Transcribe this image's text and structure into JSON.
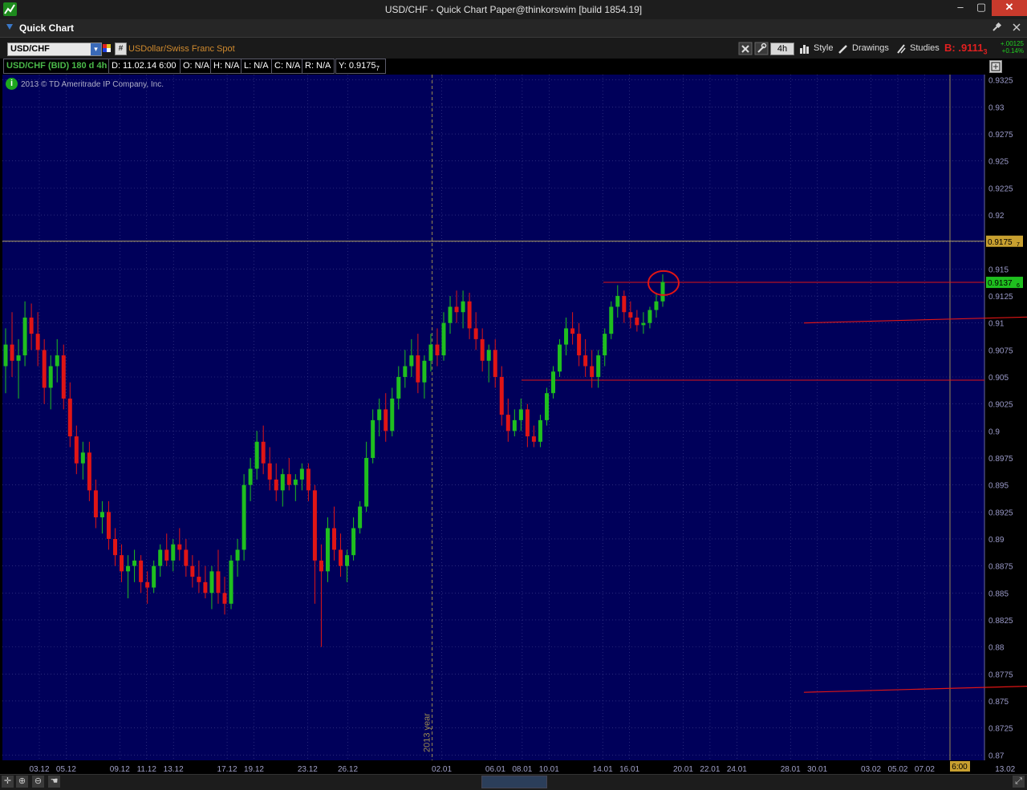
{
  "window": {
    "title": "USD/CHF - Quick Chart Paper@thinkorswim [build 1854.19]",
    "min_glyph": "–",
    "max_glyph": "▢",
    "close_glyph": "✕"
  },
  "panel": {
    "title": "Quick Chart"
  },
  "toolbar": {
    "symbol": "USD/CHF",
    "symbol_description": "USDollar/Swiss Franc Spot",
    "timeframe": "4h",
    "style_label": "Style",
    "drawings_label": "Drawings",
    "studies_label": "Studies",
    "bid_label": "B: .9111",
    "bid_sub": "3",
    "change_abs": "+.00125",
    "change_pct": "+0.14%"
  },
  "info": {
    "symbol_period": "USD/CHF (BID) 180 d 4h",
    "date": "D: 11.02.14 6:00",
    "open": "O: N/A",
    "high": "H: N/A",
    "low": "L: N/A",
    "close": "C: N/A",
    "range": "R: N/A",
    "y": "Y: 0.9175",
    "y_sub": "7"
  },
  "copyright": "2013 © TD Ameritrade IP Company, Inc.",
  "colors": {
    "background": "#00005a",
    "grid": "#444490",
    "up": "#1fbf1f",
    "down": "#e01515",
    "trend": "#e01515",
    "axis_text": "#9a9ac8",
    "date_text": "#a0a0c8",
    "crosshair": "#b0a060"
  },
  "chart_data": {
    "type": "candlestick",
    "title": "USD/CHF (BID) 180 d 4h",
    "y_ticks": [
      0.9325,
      0.93,
      0.9275,
      0.925,
      0.9225,
      0.92,
      0.9175,
      0.915,
      0.9125,
      0.91,
      0.9075,
      0.905,
      0.9025,
      0.9,
      0.8975,
      0.895,
      0.8925,
      0.89,
      0.8875,
      0.885,
      0.8825,
      0.88,
      0.8775,
      0.875,
      0.8725,
      0.87
    ],
    "y_tick_labels": [
      "0.9325",
      "0.93",
      "0.9275",
      "0.925",
      "0.9225",
      "0.92",
      "0.9175",
      "0.915",
      "0.9125",
      "0.91",
      "0.9075",
      "0.905",
      "0.9025",
      "0.9",
      "0.8975",
      "0.895",
      "0.8925",
      "0.89",
      "0.8875",
      "0.885",
      "0.8825",
      "0.88",
      "0.8775",
      "0.875",
      "0.8725",
      "0.87"
    ],
    "ylim": [
      0.8695,
      0.933
    ],
    "x_ticks": [
      "03.12",
      "05.12",
      "09.12",
      "11.12",
      "13.12",
      "17.12",
      "19.12",
      "23.12",
      "26.12",
      "02.01",
      "06.01",
      "08.01",
      "10.01",
      "14.01",
      "16.01",
      "20.01",
      "22.01",
      "24.01",
      "28.01",
      "30.01",
      "03.02",
      "05.02",
      "07.02",
      "13.02"
    ],
    "current_time_label": "6:00",
    "year_marker": "2013 year",
    "crosshair_price": 0.91757,
    "crosshair_label": "0.9175",
    "crosshair_label_sub": "7",
    "last_price": 0.91376,
    "last_price_label": "0.9137",
    "last_price_label_sub": "6",
    "horizontal_lines": [
      0.91376,
      0.9047
    ],
    "trend_lines": [
      {
        "from": [
          "29.11",
          0.92
        ],
        "to": [
          "29.01",
          0.91
        ]
      },
      {
        "from": [
          "29.11",
          0.886
        ],
        "to": [
          "29.01",
          0.8758
        ]
      }
    ],
    "highlight_circle": {
      "date": "21.01",
      "price": 0.9137
    },
    "candles": [
      [
        "02.12 00:00",
        0.906,
        0.9095,
        0.9035,
        0.908
      ],
      [
        "02.12 08:00",
        0.908,
        0.911,
        0.905,
        0.9065
      ],
      [
        "02.12 16:00",
        0.9065,
        0.9085,
        0.903,
        0.907
      ],
      [
        "03.12 00:00",
        0.907,
        0.912,
        0.906,
        0.9105
      ],
      [
        "03.12 08:00",
        0.9105,
        0.9118,
        0.9075,
        0.909
      ],
      [
        "03.12 16:00",
        0.909,
        0.911,
        0.906,
        0.9075
      ],
      [
        "04.12 00:00",
        0.9075,
        0.9085,
        0.9025,
        0.904
      ],
      [
        "04.12 08:00",
        0.904,
        0.907,
        0.902,
        0.906
      ],
      [
        "04.12 16:00",
        0.906,
        0.9085,
        0.9045,
        0.907
      ],
      [
        "05.12 00:00",
        0.907,
        0.908,
        0.902,
        0.903
      ],
      [
        "05.12 08:00",
        0.903,
        0.9045,
        0.8985,
        0.8995
      ],
      [
        "05.12 16:00",
        0.8995,
        0.9005,
        0.896,
        0.897
      ],
      [
        "06.12 00:00",
        0.897,
        0.899,
        0.8955,
        0.898
      ],
      [
        "06.12 08:00",
        0.898,
        0.899,
        0.8935,
        0.8945
      ],
      [
        "06.12 16:00",
        0.8945,
        0.8955,
        0.891,
        0.892
      ],
      [
        "09.12 00:00",
        0.892,
        0.8935,
        0.8905,
        0.8925
      ],
      [
        "09.12 08:00",
        0.8925,
        0.8935,
        0.889,
        0.89
      ],
      [
        "09.12 16:00",
        0.89,
        0.891,
        0.8875,
        0.8885
      ],
      [
        "10.12 00:00",
        0.8885,
        0.8895,
        0.886,
        0.887
      ],
      [
        "10.12 08:00",
        0.887,
        0.8885,
        0.8845,
        0.8875
      ],
      [
        "10.12 16:00",
        0.8875,
        0.889,
        0.886,
        0.888
      ],
      [
        "11.12 00:00",
        0.888,
        0.8885,
        0.885,
        0.886
      ],
      [
        "11.12 08:00",
        0.886,
        0.887,
        0.884,
        0.8855
      ],
      [
        "11.12 16:00",
        0.8855,
        0.888,
        0.885,
        0.8875
      ],
      [
        "12.12 00:00",
        0.8875,
        0.8895,
        0.8865,
        0.889
      ],
      [
        "12.12 08:00",
        0.889,
        0.8905,
        0.8875,
        0.888
      ],
      [
        "12.12 16:00",
        0.888,
        0.89,
        0.887,
        0.8895
      ],
      [
        "13.12 00:00",
        0.8895,
        0.891,
        0.888,
        0.889
      ],
      [
        "13.12 08:00",
        0.889,
        0.89,
        0.8865,
        0.8875
      ],
      [
        "13.12 16:00",
        0.8875,
        0.8885,
        0.8855,
        0.8865
      ],
      [
        "16.12 00:00",
        0.8865,
        0.888,
        0.885,
        0.886
      ],
      [
        "16.12 08:00",
        0.886,
        0.8875,
        0.8845,
        0.885
      ],
      [
        "16.12 16:00",
        0.885,
        0.8875,
        0.8835,
        0.887
      ],
      [
        "17.12 00:00",
        0.887,
        0.889,
        0.884,
        0.885
      ],
      [
        "17.12 08:00",
        0.885,
        0.8865,
        0.883,
        0.884
      ],
      [
        "17.12 16:00",
        0.884,
        0.8885,
        0.8835,
        0.888
      ],
      [
        "18.12 00:00",
        0.888,
        0.89,
        0.8865,
        0.889
      ],
      [
        "18.12 08:00",
        0.889,
        0.896,
        0.888,
        0.895
      ],
      [
        "18.12 16:00",
        0.895,
        0.8975,
        0.8935,
        0.8965
      ],
      [
        "19.12 00:00",
        0.8965,
        0.9,
        0.8955,
        0.899
      ],
      [
        "19.12 08:00",
        0.899,
        0.9005,
        0.896,
        0.897
      ],
      [
        "19.12 16:00",
        0.897,
        0.8985,
        0.8945,
        0.8955
      ],
      [
        "20.12 00:00",
        0.8955,
        0.897,
        0.8935,
        0.8945
      ],
      [
        "20.12 08:00",
        0.8945,
        0.8965,
        0.893,
        0.896
      ],
      [
        "20.12 16:00",
        0.896,
        0.8975,
        0.8945,
        0.895
      ],
      [
        "23.12 00:00",
        0.895,
        0.896,
        0.8935,
        0.8955
      ],
      [
        "23.12 08:00",
        0.8955,
        0.897,
        0.8945,
        0.8965
      ],
      [
        "23.12 16:00",
        0.8965,
        0.897,
        0.8935,
        0.8945
      ],
      [
        "24.12 00:00",
        0.8945,
        0.895,
        0.884,
        0.888
      ],
      [
        "24.12 08:00",
        0.888,
        0.8895,
        0.88,
        0.887
      ],
      [
        "24.12 16:00",
        0.887,
        0.892,
        0.886,
        0.891
      ],
      [
        "26.12 00:00",
        0.891,
        0.893,
        0.888,
        0.889
      ],
      [
        "26.12 08:00",
        0.889,
        0.8905,
        0.8865,
        0.8875
      ],
      [
        "26.12 16:00",
        0.8875,
        0.889,
        0.886,
        0.8885
      ],
      [
        "27.12 00:00",
        0.8885,
        0.892,
        0.888,
        0.891
      ],
      [
        "27.12 08:00",
        0.891,
        0.8935,
        0.8905,
        0.893
      ],
      [
        "27.12 16:00",
        0.893,
        0.899,
        0.8925,
        0.8975
      ],
      [
        "30.12 00:00",
        0.8975,
        0.902,
        0.897,
        0.901
      ],
      [
        "30.12 08:00",
        0.901,
        0.903,
        0.8995,
        0.902
      ],
      [
        "30.12 16:00",
        0.902,
        0.9035,
        0.899,
        0.9
      ],
      [
        "31.12 00:00",
        0.9,
        0.904,
        0.8995,
        0.903
      ],
      [
        "31.12 08:00",
        0.903,
        0.906,
        0.902,
        0.905
      ],
      [
        "02.01 00:00",
        0.905,
        0.9075,
        0.904,
        0.906
      ],
      [
        "02.01 08:00",
        0.906,
        0.9085,
        0.905,
        0.907
      ],
      [
        "02.01 16:00",
        0.907,
        0.909,
        0.9035,
        0.9045
      ],
      [
        "03.01 00:00",
        0.9045,
        0.907,
        0.903,
        0.9065
      ],
      [
        "03.01 08:00",
        0.9065,
        0.909,
        0.9055,
        0.908
      ],
      [
        "03.01 16:00",
        0.908,
        0.9095,
        0.906,
        0.907
      ],
      [
        "06.01 00:00",
        0.907,
        0.911,
        0.9065,
        0.91
      ],
      [
        "06.01 08:00",
        0.91,
        0.9125,
        0.909,
        0.9115
      ],
      [
        "06.01 16:00",
        0.9115,
        0.913,
        0.91,
        0.911
      ],
      [
        "07.01 00:00",
        0.911,
        0.913,
        0.9095,
        0.912
      ],
      [
        "07.01 08:00",
        0.912,
        0.9128,
        0.9085,
        0.9095
      ],
      [
        "07.01 16:00",
        0.9095,
        0.911,
        0.9075,
        0.9085
      ],
      [
        "08.01 00:00",
        0.9085,
        0.9095,
        0.9055,
        0.9065
      ],
      [
        "08.01 08:00",
        0.9065,
        0.908,
        0.9045,
        0.9075
      ],
      [
        "08.01 16:00",
        0.9075,
        0.9085,
        0.904,
        0.905
      ],
      [
        "09.01 00:00",
        0.905,
        0.906,
        0.9005,
        0.9015
      ],
      [
        "09.01 08:00",
        0.9015,
        0.903,
        0.899,
        0.9
      ],
      [
        "09.01 16:00",
        0.9,
        0.902,
        0.8995,
        0.901
      ],
      [
        "10.01 00:00",
        0.901,
        0.903,
        0.9,
        0.902
      ],
      [
        "10.01 08:00",
        0.902,
        0.9025,
        0.8985,
        0.8995
      ],
      [
        "10.01 16:00",
        0.8995,
        0.9005,
        0.8985,
        0.899
      ],
      [
        "13.01 00:00",
        0.899,
        0.9015,
        0.8985,
        0.901
      ],
      [
        "13.01 08:00",
        0.901,
        0.904,
        0.9005,
        0.9035
      ],
      [
        "13.01 16:00",
        0.9035,
        0.906,
        0.903,
        0.9055
      ],
      [
        "14.01 00:00",
        0.9055,
        0.9085,
        0.905,
        0.908
      ],
      [
        "14.01 08:00",
        0.908,
        0.9105,
        0.907,
        0.9095
      ],
      [
        "14.01 16:00",
        0.9095,
        0.911,
        0.908,
        0.909
      ],
      [
        "15.01 00:00",
        0.909,
        0.91,
        0.906,
        0.907
      ],
      [
        "15.01 08:00",
        0.907,
        0.9085,
        0.905,
        0.906
      ],
      [
        "15.01 16:00",
        0.906,
        0.9075,
        0.904,
        0.905
      ],
      [
        "16.01 00:00",
        0.905,
        0.9075,
        0.904,
        0.907
      ],
      [
        "16.01 08:00",
        0.907,
        0.9095,
        0.906,
        0.909
      ],
      [
        "16.01 16:00",
        0.909,
        0.912,
        0.9085,
        0.9115
      ],
      [
        "17.01 00:00",
        0.9115,
        0.9135,
        0.9105,
        0.9125
      ],
      [
        "17.01 08:00",
        0.9125,
        0.913,
        0.91,
        0.911
      ],
      [
        "17.01 16:00",
        0.911,
        0.912,
        0.9095,
        0.9105
      ],
      [
        "20.01 00:00",
        0.9105,
        0.9112,
        0.9092,
        0.9098
      ],
      [
        "20.01 08:00",
        0.9098,
        0.911,
        0.909,
        0.91
      ],
      [
        "20.01 16:00",
        0.91,
        0.9115,
        0.9095,
        0.9112
      ],
      [
        "21.01 00:00",
        0.9112,
        0.9128,
        0.9105,
        0.912
      ],
      [
        "21.01 08:00",
        0.912,
        0.9145,
        0.9115,
        0.9138
      ]
    ]
  }
}
